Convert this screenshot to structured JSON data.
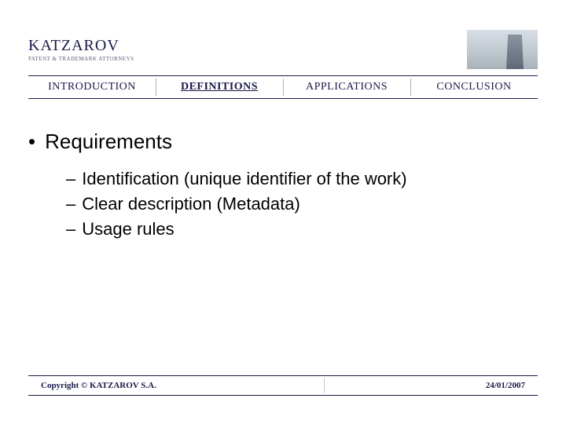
{
  "header": {
    "brand_name": "KATZAROV",
    "brand_tag": "PATENT & TRADEMARK ATTORNEYS"
  },
  "nav": {
    "items": [
      {
        "label": "INTRODUCTION",
        "active": false
      },
      {
        "label": "DEFINITIONS",
        "active": true
      },
      {
        "label": "APPLICATIONS",
        "active": false
      },
      {
        "label": "CONCLUSION",
        "active": false
      }
    ]
  },
  "content": {
    "heading": "Requirements",
    "items": [
      "Identification (unique identifier of the work)",
      "Clear description (Metadata)",
      "Usage rules"
    ]
  },
  "footer": {
    "copyright": "Copyright © KATZAROV S.A.",
    "date": "24/01/2007"
  }
}
